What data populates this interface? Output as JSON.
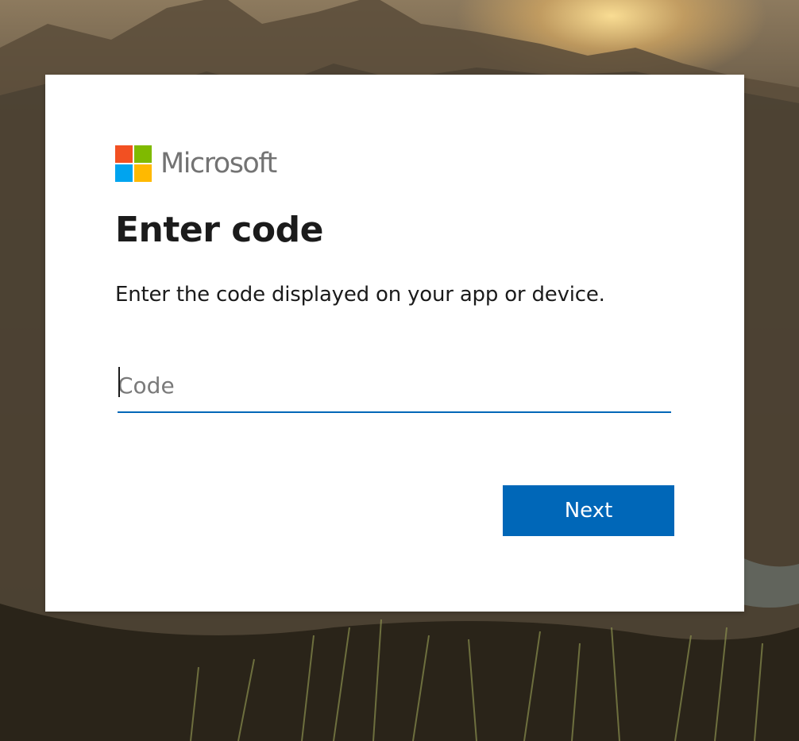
{
  "brand": {
    "name": "Microsoft",
    "logo_icon": "microsoft-logo-icon",
    "logo_colors": [
      "#f25022",
      "#7fba00",
      "#00a4ef",
      "#ffb900"
    ]
  },
  "page": {
    "title": "Enter code",
    "description": "Enter the code displayed on your app or device."
  },
  "code_field": {
    "placeholder": "Code",
    "value": ""
  },
  "actions": {
    "next_label": "Next"
  },
  "colors": {
    "accent": "#0067b8",
    "card_background": "#ffffff",
    "text": "#1b1b1b"
  }
}
